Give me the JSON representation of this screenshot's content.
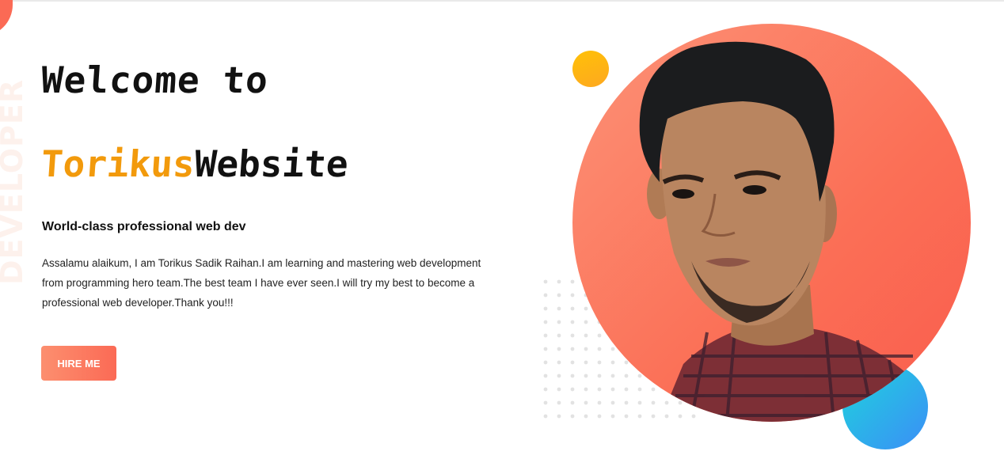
{
  "hero": {
    "side_text": "DEVELOPER",
    "welcome": "Welcome to",
    "name_accent": "Torikus",
    "name_rest": "Website",
    "subheading": "World-class professional web dev",
    "intro": "Assalamu alaikum, I am Torikus Sadik Raihan.I am learning and mastering web development from programming hero team.The best team I have ever seen.I will try my best to become a professional web developer.Thank you!!!",
    "cta_label": "HIRE ME"
  },
  "colors": {
    "accent_orange": "#f29a0c",
    "coral": "#fb6a55",
    "yellow": "#ffc107",
    "blue": "#3b8ef7",
    "cyan": "#1ed4dc"
  }
}
